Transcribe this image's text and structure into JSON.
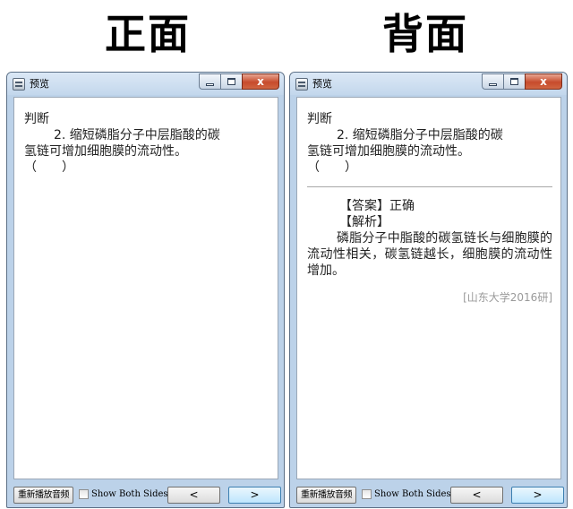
{
  "headings": {
    "front": "正面",
    "back": "背面"
  },
  "front_window": {
    "title": "预览",
    "close_glyph": "x",
    "content": {
      "type": "判断",
      "question_line1": "2. 缩短磷脂分子中层脂酸的碳",
      "question_line2": "氢链可增加细胞膜的流动性。",
      "blank": "（　　）"
    },
    "footer": {
      "replay_label": "重新播放音频",
      "show_both_label": "Show Both Sides",
      "prev_label": "<",
      "next_label": ">"
    }
  },
  "back_window": {
    "title": "预览",
    "close_glyph": "x",
    "content": {
      "type": "判断",
      "question_line1": "2. 缩短磷脂分子中层脂酸的碳",
      "question_line2": "氢链可增加细胞膜的流动性。",
      "blank": "（　　）",
      "answer": "【答案】正确",
      "analysis_heading": "【解析】",
      "analysis_text": "磷脂分子中脂酸的碳氢链长与细胞膜的流动性相关，碳氢链越长，细胞膜的流动性增加。",
      "source": "[山东大学2016研]"
    },
    "footer": {
      "replay_label": "重新播放音频",
      "show_both_label": "Show Both Sides",
      "prev_label": "<",
      "next_label": ">"
    }
  },
  "icons": [
    "app-icon",
    "minimize-icon",
    "maximize-icon",
    "close-icon"
  ],
  "colors": {
    "frame": "#bcd2e9",
    "close_button": "#c74b2c",
    "source_text": "#9a9a9a"
  }
}
